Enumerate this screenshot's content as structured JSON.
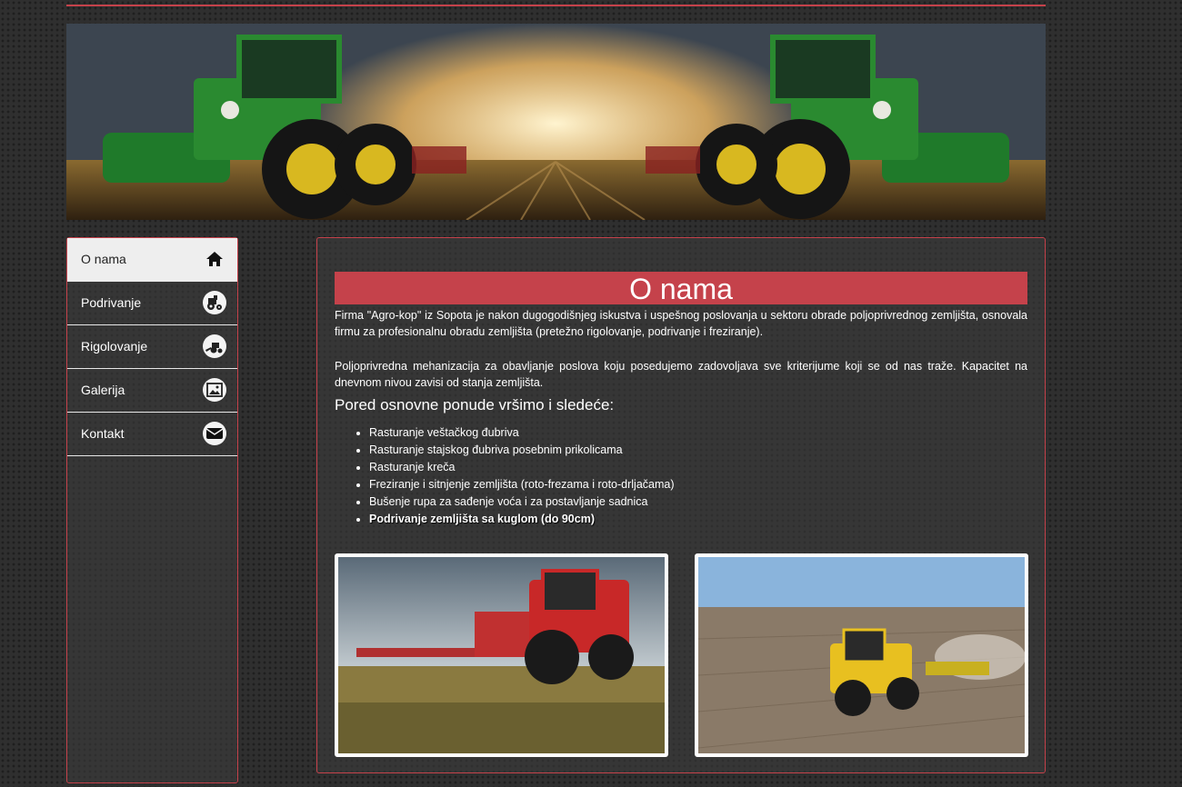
{
  "banner": {
    "alt": "tractor-banner"
  },
  "nav": {
    "items": [
      {
        "label": "O nama",
        "icon": "home-icon"
      },
      {
        "label": "Podrivanje",
        "icon": "tractor-icon"
      },
      {
        "label": "Rigolovanje",
        "icon": "plough-icon"
      },
      {
        "label": "Galerija",
        "icon": "image-icon"
      },
      {
        "label": "Kontakt",
        "icon": "envelope-icon"
      }
    ]
  },
  "main": {
    "title": "O nama",
    "paragraph1": "Firma \"Agro-kop\" iz Sopota je nakon dugogodišnjeg iskustva i uspešnog poslovanja u sektoru obrade poljoprivrednog zemljišta, osnovala firmu za profesionalnu obradu zemljišta (pretežno rigolovanje, podrivanje i freziranje).",
    "paragraph2": "Poljoprivredna mehanizacija za obavljanje poslova koju posedujemo zadovoljava sve kriterijume koji se od nas traže. Kapacitet na dnevnom nivou zavisi od stanja zemljišta.",
    "subheading": "Pored osnovne ponude vršimo i sledeće:",
    "services": [
      "Rasturanje veštačkog đubriva",
      "Rasturanje stajskog đubriva posebnim prikolicama",
      "Rasturanje kreča",
      "Freziranje i sitnjenje zemljišta (roto-frezama i roto-drljačama)",
      "Bušenje rupa za sađenje voća i za postavljanje sadnica",
      "Podrivanje zemljišta sa kuglom (do 90cm)"
    ]
  },
  "colors": {
    "accent": "#c5424b",
    "background": "#2f2f2f"
  }
}
